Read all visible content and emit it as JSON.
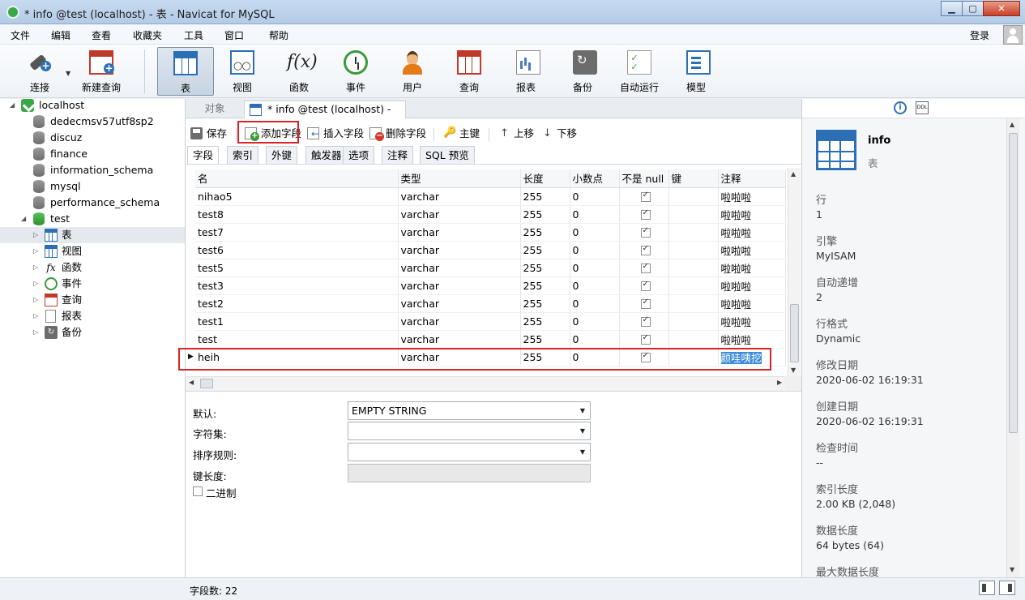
{
  "window": {
    "title": "* info @test (localhost) - 表 - Navicat for MySQL",
    "minimize": "▁",
    "maximize": "▢",
    "close": "✕"
  },
  "menu": [
    "文件",
    "编辑",
    "查看",
    "收藏夹",
    "工具",
    "窗口",
    "帮助"
  ],
  "login": "登录",
  "toolbar": [
    {
      "label": "连接",
      "icon": "plug-icon"
    },
    {
      "label": "新建查询",
      "icon": "new-query-icon"
    },
    {
      "label": "表",
      "icon": "table-icon",
      "active": true
    },
    {
      "label": "视图",
      "icon": "view-icon"
    },
    {
      "label": "函数",
      "icon": "function-icon",
      "glyph": "f(x)"
    },
    {
      "label": "事件",
      "icon": "clock-icon"
    },
    {
      "label": "用户",
      "icon": "user-icon"
    },
    {
      "label": "查询",
      "icon": "query-icon"
    },
    {
      "label": "报表",
      "icon": "report-icon"
    },
    {
      "label": "备份",
      "icon": "backup-icon"
    },
    {
      "label": "自动运行",
      "icon": "schedule-icon"
    },
    {
      "label": "模型",
      "icon": "model-icon"
    }
  ],
  "tree": {
    "connection": "localhost",
    "databases": [
      "dedecmsv57utf8sp2",
      "discuz",
      "finance",
      "information_schema",
      "mysql",
      "performance_schema",
      "test"
    ],
    "test_children": [
      "表",
      "视图",
      "函数",
      "事件",
      "查询",
      "报表",
      "备份"
    ]
  },
  "tabs": {
    "objects": "对象",
    "active": "* info @test (localhost) - 表"
  },
  "subtoolbar": {
    "save": "保存",
    "add_field": "添加字段",
    "insert_field": "插入字段",
    "delete_field": "删除字段",
    "primary_key": "主键",
    "move_up": "上移",
    "move_down": "下移"
  },
  "inner_tabs": [
    "字段",
    "索引",
    "外键",
    "触发器",
    "选项",
    "注释",
    "SQL 预览"
  ],
  "grid": {
    "columns": [
      "名",
      "类型",
      "长度",
      "小数点",
      "不是 null",
      "键",
      "注释"
    ],
    "rows": [
      {
        "name": "nihao5",
        "type": "varchar",
        "length": "255",
        "decimals": "0",
        "not_null": true,
        "key": "",
        "comment": "啦啦啦"
      },
      {
        "name": "test8",
        "type": "varchar",
        "length": "255",
        "decimals": "0",
        "not_null": true,
        "key": "",
        "comment": "啦啦啦"
      },
      {
        "name": "test7",
        "type": "varchar",
        "length": "255",
        "decimals": "0",
        "not_null": true,
        "key": "",
        "comment": "啦啦啦"
      },
      {
        "name": "test6",
        "type": "varchar",
        "length": "255",
        "decimals": "0",
        "not_null": true,
        "key": "",
        "comment": "啦啦啦"
      },
      {
        "name": "test5",
        "type": "varchar",
        "length": "255",
        "decimals": "0",
        "not_null": true,
        "key": "",
        "comment": "啦啦啦"
      },
      {
        "name": "test3",
        "type": "varchar",
        "length": "255",
        "decimals": "0",
        "not_null": true,
        "key": "",
        "comment": "啦啦啦"
      },
      {
        "name": "test2",
        "type": "varchar",
        "length": "255",
        "decimals": "0",
        "not_null": true,
        "key": "",
        "comment": "啦啦啦"
      },
      {
        "name": "test1",
        "type": "varchar",
        "length": "255",
        "decimals": "0",
        "not_null": true,
        "key": "",
        "comment": "啦啦啦"
      },
      {
        "name": "test",
        "type": "varchar",
        "length": "255",
        "decimals": "0",
        "not_null": true,
        "key": "",
        "comment": "啦啦啦"
      },
      {
        "name": "heih",
        "type": "varchar",
        "length": "255",
        "decimals": "0",
        "not_null": true,
        "key": "",
        "comment": "颜哇咦挖",
        "current": true
      }
    ]
  },
  "properties": {
    "default_label": "默认:",
    "default_value": "EMPTY STRING",
    "charset_label": "字符集:",
    "charset_value": "",
    "collation_label": "排序规则:",
    "collation_value": "",
    "key_length_label": "键长度:",
    "key_length_value": "",
    "binary_label": "二进制"
  },
  "info": {
    "name": "info",
    "type": "表",
    "fields": [
      {
        "key": "行",
        "value": "1"
      },
      {
        "key": "引擎",
        "value": "MyISAM"
      },
      {
        "key": "自动递增",
        "value": "2"
      },
      {
        "key": "行格式",
        "value": "Dynamic"
      },
      {
        "key": "修改日期",
        "value": "2020-06-02 16:19:31"
      },
      {
        "key": "创建日期",
        "value": "2020-06-02 16:19:31"
      },
      {
        "key": "检查时间",
        "value": "--"
      },
      {
        "key": "索引长度",
        "value": "2.00 KB (2,048)"
      },
      {
        "key": "数据长度",
        "value": "64 bytes (64)"
      },
      {
        "key": "最大数据长度",
        "value": ""
      }
    ],
    "info_btn": "i",
    "ddl_btn": "DDL"
  },
  "status": {
    "field_count": "字段数: 22"
  }
}
